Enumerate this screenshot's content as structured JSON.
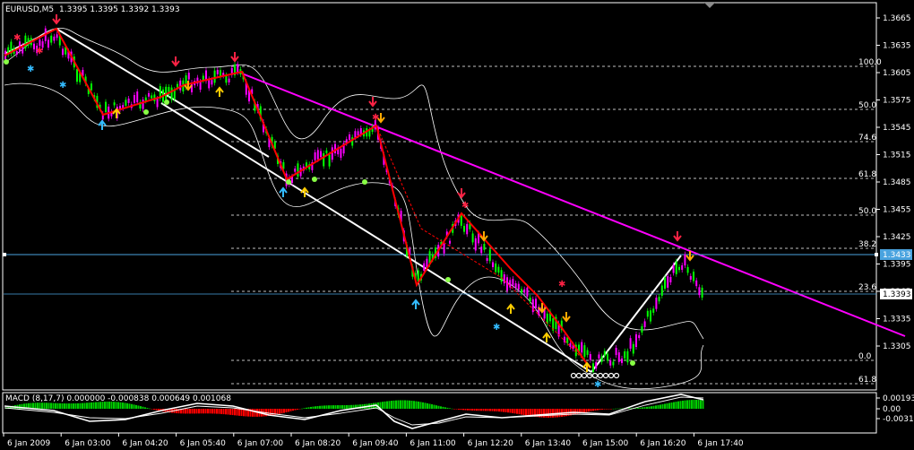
{
  "window": {
    "symbol_title": "EURUSD,M5",
    "ohlc": "1.3395 1.3395 1.3392 1.3393"
  },
  "price_axis": {
    "ticks": [
      "1.3665",
      "1.3635",
      "1.3605",
      "1.3575",
      "1.3545",
      "1.3515",
      "1.3485",
      "1.3455",
      "1.3425",
      "1.3395",
      "1.3365",
      "1.3335",
      "1.3305"
    ],
    "current_price": "1.3393",
    "line_price": "1.3433"
  },
  "fibo_levels": [
    "100.0",
    "50.0",
    "74.6",
    "61.8",
    "50.0",
    "38.2",
    "23.6",
    "0.0",
    "61.8"
  ],
  "time_axis": {
    "ticks": [
      "6 Jan 2009",
      "6 Jan 03:00",
      "6 Jan 04:20",
      "6 Jan 05:40",
      "6 Jan 07:00",
      "6 Jan 08:20",
      "6 Jan 09:40",
      "6 Jan 11:00",
      "6 Jan 12:20",
      "6 Jan 13:40",
      "6 Jan 15:00",
      "6 Jan 16:20",
      "6 Jan 17:40"
    ]
  },
  "macd": {
    "label": "MACD  (8,17,7) 0.000000 -0.000838 0.000649 0.001068",
    "ticks": [
      "0.00193",
      "0.00",
      "-0.0031"
    ]
  },
  "colors": {
    "background": "#000000",
    "grid": "#ffffff",
    "up_candle": "#00ff00",
    "down_candle": "#ff00ff",
    "zigzag": "#ff0000",
    "trendline": "#ff00ff",
    "channel": "#ffffff",
    "price_line": "#4aa3df",
    "macd_pos": "#00cc00",
    "macd_neg": "#ff0000"
  }
}
